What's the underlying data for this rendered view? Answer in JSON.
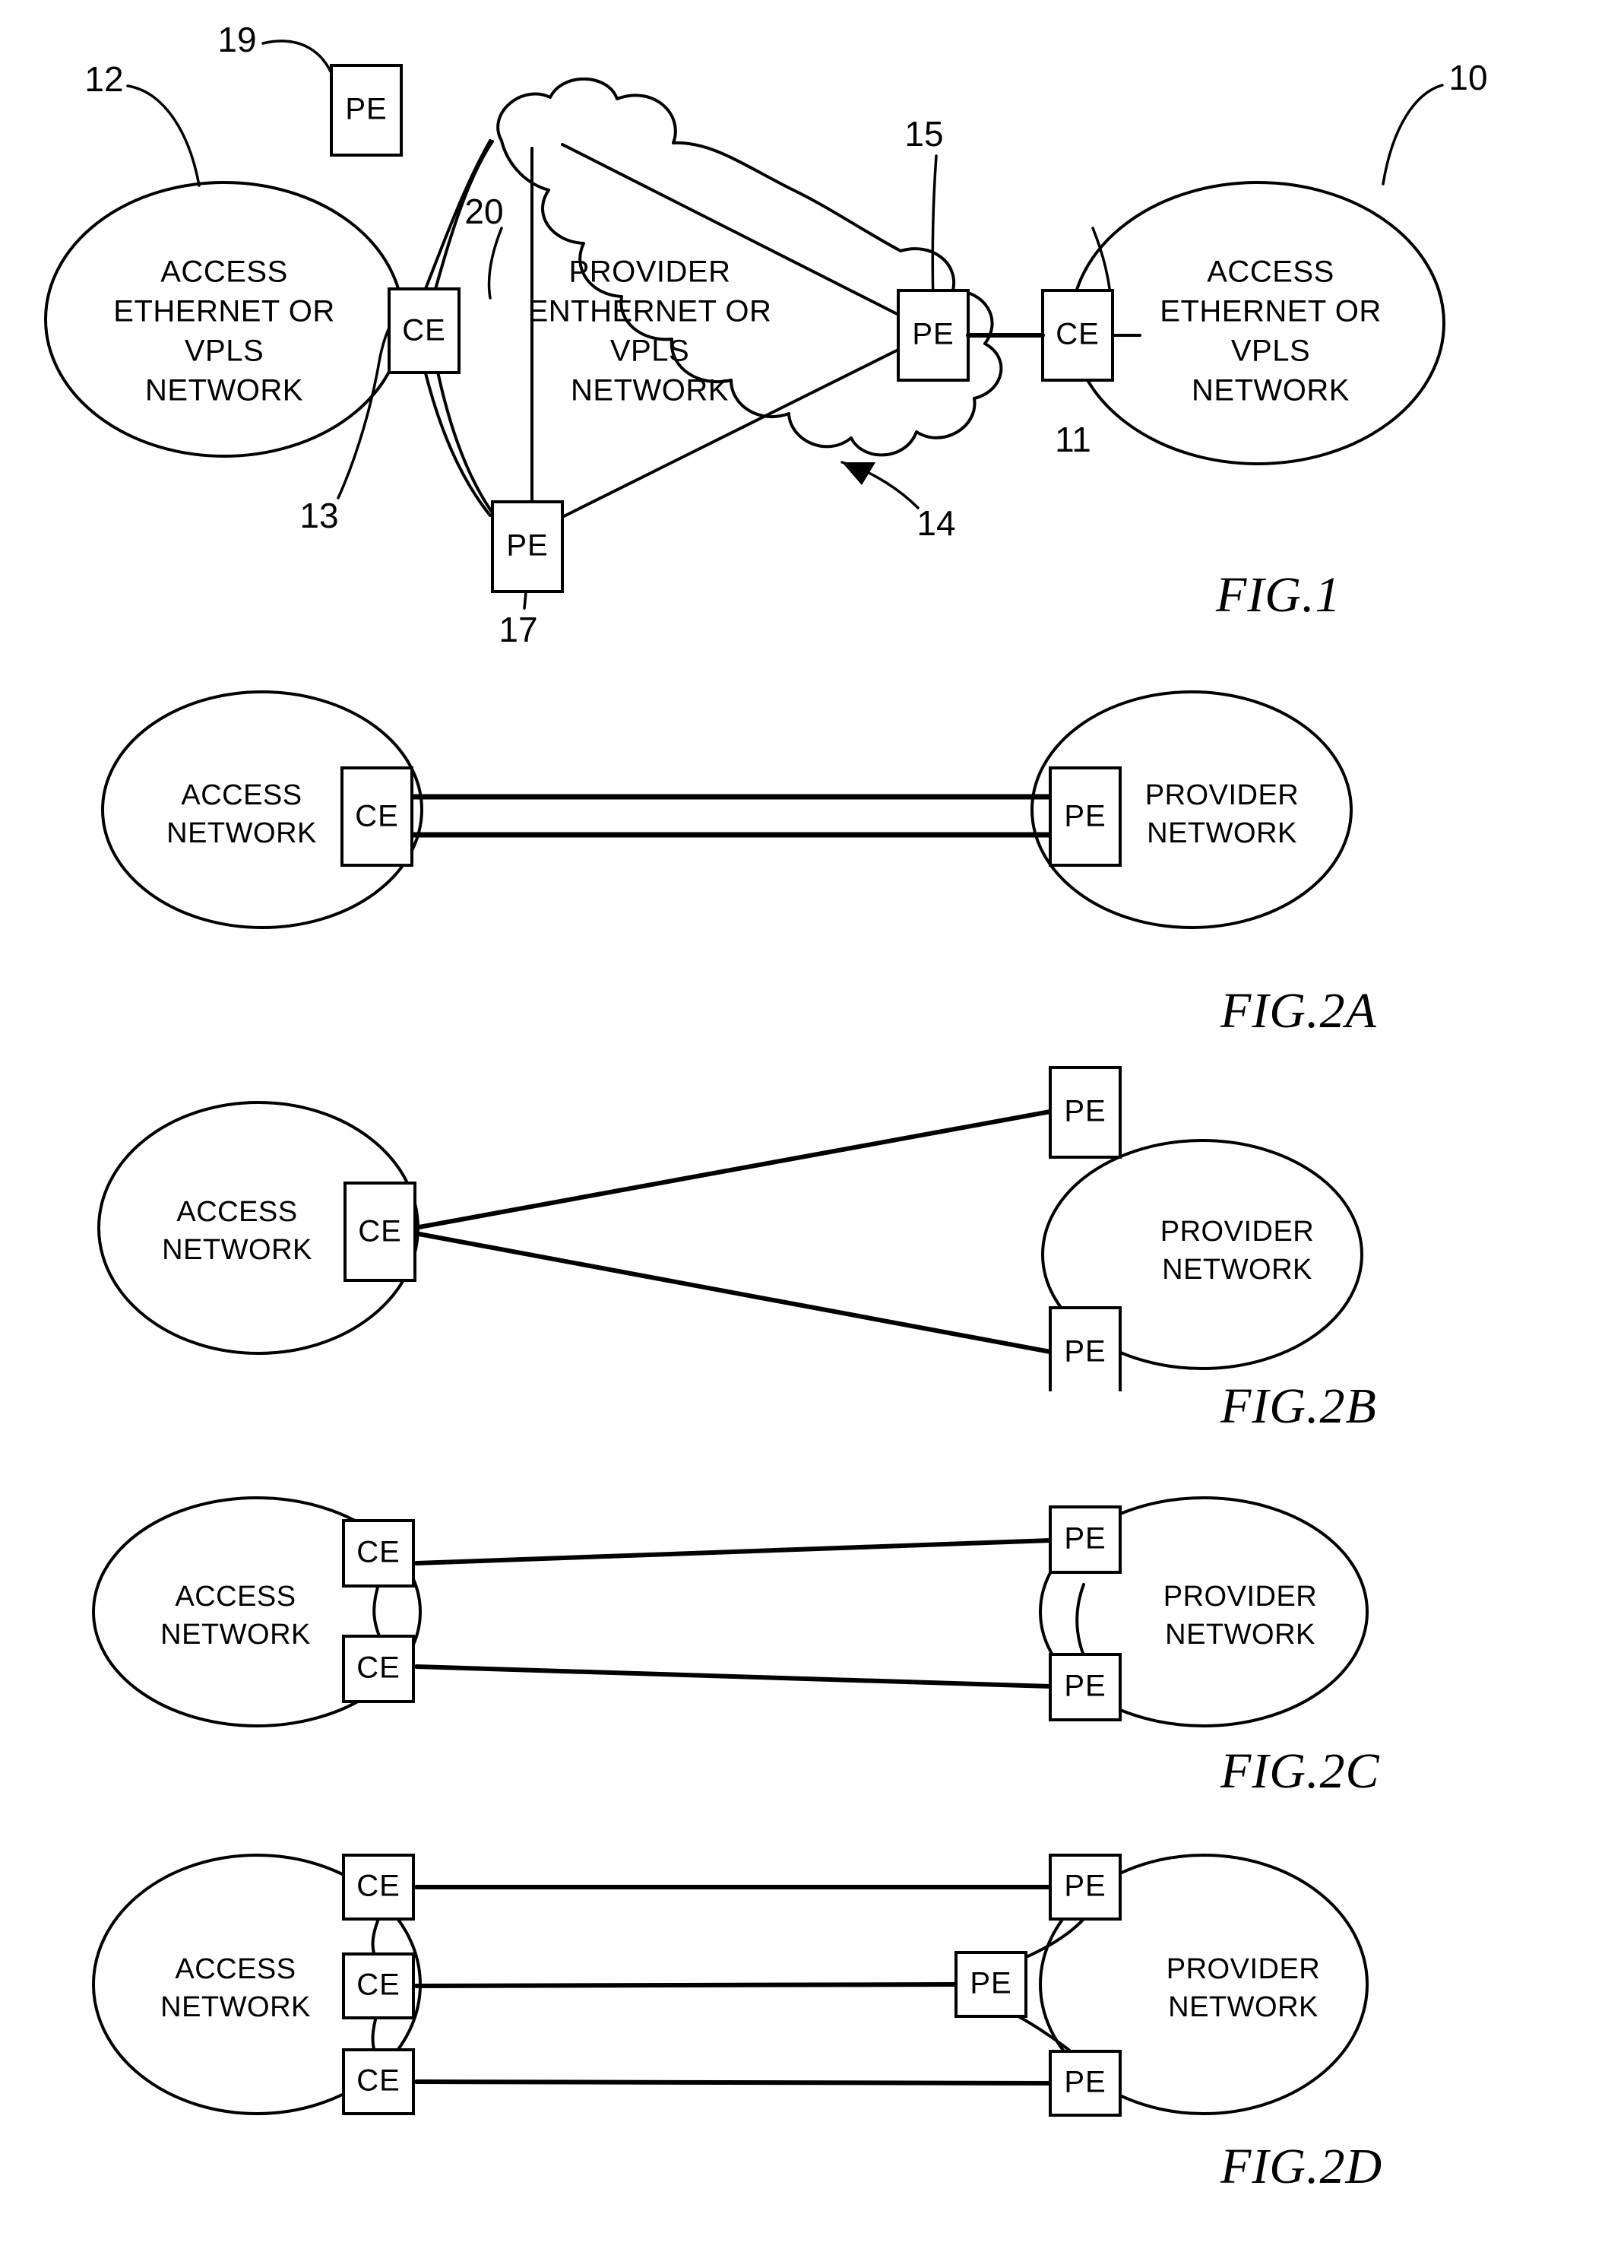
{
  "document": {
    "type": "patent-drawing-sheet",
    "background_color": "#ffffff",
    "ink_color": "#000000"
  },
  "figures": [
    {
      "id": "fig1",
      "caption": "FIG.1",
      "clouds": [
        {
          "name": "access-network-left",
          "lines": [
            "ACCESS",
            "ETHERNET  OR",
            "VPLS",
            "NETWORK"
          ],
          "shape": "ellipse"
        },
        {
          "name": "provider-network-center",
          "lines": [
            "PROVIDER",
            "ENTHERNET  OR",
            "VPLS",
            "NETWORK"
          ],
          "shape": "cloud"
        },
        {
          "name": "access-network-right",
          "lines": [
            "ACCESS",
            "ETHERNET  OR",
            "VPLS",
            "NETWORK"
          ],
          "shape": "ellipse"
        }
      ],
      "nodes": [
        {
          "name": "pe-top",
          "label": "PE"
        },
        {
          "name": "ce-left",
          "label": "CE"
        },
        {
          "name": "pe-bottom",
          "label": "PE"
        },
        {
          "name": "pe-right",
          "label": "PE"
        },
        {
          "name": "ce-right",
          "label": "CE"
        }
      ],
      "reference_numerals": [
        {
          "id": "n19",
          "value": "19",
          "points_to": "pe-top"
        },
        {
          "id": "n12",
          "value": "12",
          "points_to": "access-network-left"
        },
        {
          "id": "n15",
          "value": "15",
          "points_to": "pe-right"
        },
        {
          "id": "n10",
          "value": "10",
          "points_to": "access-network-right"
        },
        {
          "id": "n20",
          "value": "20",
          "points_to": "ce-left-to-pe-bottom-link"
        },
        {
          "id": "n13",
          "value": "13",
          "points_to": "ce-left-link"
        },
        {
          "id": "n11",
          "value": "11",
          "points_to": "ce-right"
        },
        {
          "id": "n17",
          "value": "17",
          "points_to": "pe-bottom"
        },
        {
          "id": "n14",
          "value": "14",
          "points_to": "provider-network-center"
        }
      ]
    },
    {
      "id": "fig2a",
      "caption": "FIG.2A",
      "clouds": [
        {
          "name": "access-network",
          "lines": [
            "ACCESS",
            "NETWORK"
          ]
        },
        {
          "name": "provider-network",
          "lines": [
            "PROVIDER",
            "NETWORK"
          ]
        }
      ],
      "nodes": [
        {
          "name": "ce-1",
          "label": "CE"
        },
        {
          "name": "pe-1",
          "label": "PE"
        }
      ],
      "links": 2,
      "topology": "single CE to single PE with two parallel links"
    },
    {
      "id": "fig2b",
      "caption": "FIG.2B",
      "clouds": [
        {
          "name": "access-network",
          "lines": [
            "ACCESS",
            "NETWORK"
          ]
        },
        {
          "name": "provider-network",
          "lines": [
            "PROVIDER",
            "NETWORK"
          ]
        }
      ],
      "nodes": [
        {
          "name": "ce-1",
          "label": "CE"
        },
        {
          "name": "pe-top",
          "label": "PE"
        },
        {
          "name": "pe-bottom",
          "label": "PE"
        }
      ],
      "links": 2,
      "topology": "single CE fanning out to two PEs"
    },
    {
      "id": "fig2c",
      "caption": "FIG.2C",
      "clouds": [
        {
          "name": "access-network",
          "lines": [
            "ACCESS",
            "NETWORK"
          ]
        },
        {
          "name": "provider-network",
          "lines": [
            "PROVIDER",
            "NETWORK"
          ]
        }
      ],
      "nodes": [
        {
          "name": "ce-top",
          "label": "CE"
        },
        {
          "name": "ce-bottom",
          "label": "CE"
        },
        {
          "name": "pe-top",
          "label": "PE"
        },
        {
          "name": "pe-bottom",
          "label": "PE"
        }
      ],
      "links": 2,
      "topology": "two CEs each connected to its own PE"
    },
    {
      "id": "fig2d",
      "caption": "FIG.2D",
      "clouds": [
        {
          "name": "access-network",
          "lines": [
            "ACCESS",
            "NETWORK"
          ]
        },
        {
          "name": "provider-network",
          "lines": [
            "PROVIDER",
            "NETWORK"
          ]
        }
      ],
      "nodes": [
        {
          "name": "ce-top",
          "label": "CE"
        },
        {
          "name": "ce-middle",
          "label": "CE"
        },
        {
          "name": "ce-bottom",
          "label": "CE"
        },
        {
          "name": "pe-top",
          "label": "PE"
        },
        {
          "name": "pe-middle",
          "label": "PE"
        },
        {
          "name": "pe-bottom",
          "label": "PE"
        }
      ],
      "links": 3,
      "topology": "three CEs each connected to its own PE"
    }
  ]
}
